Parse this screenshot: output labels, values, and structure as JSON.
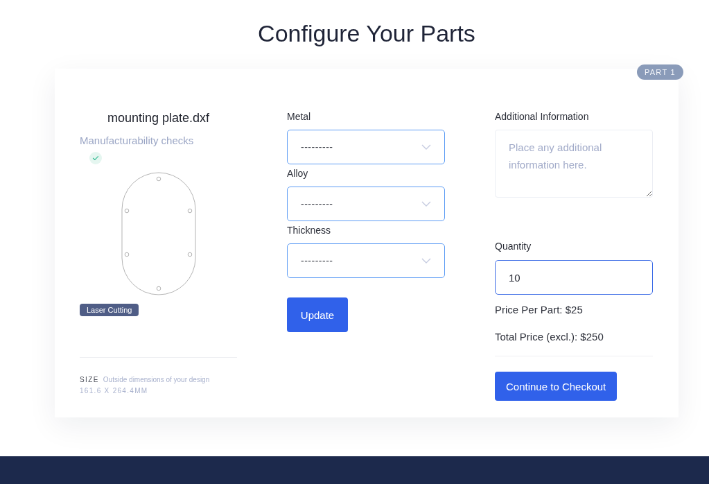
{
  "title": "Configure Your Parts",
  "part": {
    "badge": "PART 1",
    "file_name": "mounting plate.dxf",
    "manufacturability": {
      "label": "Manufacturability checks",
      "passed": true
    },
    "process_tag": "Laser Cutting",
    "size": {
      "label": "SIZE",
      "description": "Outside dimensions of your design",
      "value": "161.6 X 264.4MM"
    }
  },
  "options": [
    {
      "label": "Metal",
      "value": "---------"
    },
    {
      "label": "Alloy",
      "value": "---------"
    },
    {
      "label": "Thickness",
      "value": "---------"
    }
  ],
  "update_button": "Update",
  "additional_info": {
    "label": "Additional Information",
    "placeholder": "Place any additional information here."
  },
  "quantity": {
    "label": "Quantity",
    "value": "10"
  },
  "price_per_part": "Price Per Part: $25",
  "total_price": "Total Price (excl.): $250",
  "checkout_button": "Continue to Checkout"
}
